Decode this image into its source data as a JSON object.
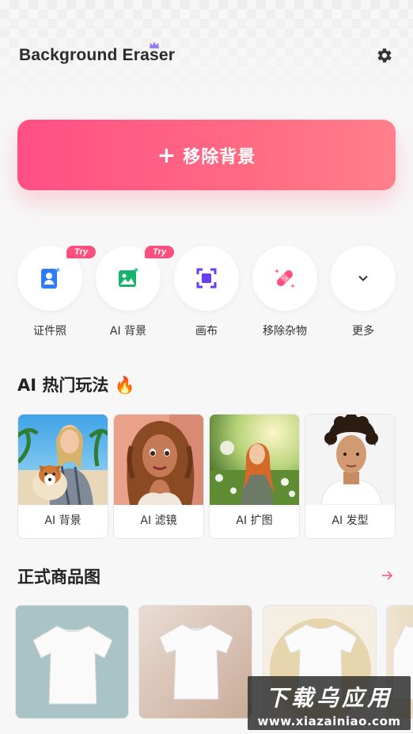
{
  "header": {
    "title": "Background Eraser"
  },
  "cta": {
    "label": "移除背景"
  },
  "tools": [
    {
      "label": "证件照",
      "badge": "Try",
      "icon": "id-photo-icon"
    },
    {
      "label": "AI 背景",
      "badge": "Try",
      "icon": "ai-background-icon"
    },
    {
      "label": "画布",
      "icon": "canvas-crop-icon"
    },
    {
      "label": "移除杂物",
      "icon": "eraser-bandage-icon"
    },
    {
      "label": "更多",
      "icon": "chevron-down-icon"
    }
  ],
  "ai_section": {
    "title": "AI 热门玩法 🔥",
    "cards": [
      {
        "label": "AI 背景"
      },
      {
        "label": "AI 滤镜"
      },
      {
        "label": "AI 扩图"
      },
      {
        "label": "AI 发型"
      }
    ]
  },
  "product_section": {
    "title": "正式商品图"
  },
  "watermark": {
    "top": "下载乌应用",
    "url": "www.xiazainiao.com"
  },
  "colors": {
    "accent": "#ff4f86",
    "accent_end": "#ff7f8c",
    "badge": "#ff4f7e"
  }
}
